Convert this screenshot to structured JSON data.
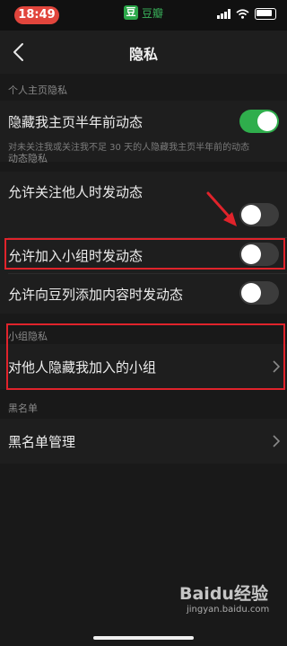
{
  "status_bar": {
    "time": "18:49",
    "app_name": "豆瓣",
    "app_logo": "豆"
  },
  "nav": {
    "title": "隐私",
    "back_icon": "chevron-left-icon"
  },
  "sections": {
    "profile": {
      "header": "个人主页隐私",
      "hide_old": {
        "label": "隐藏我主页半年前动态",
        "desc": "对未关注我或关注我不足 30 天的人隐藏我主页半年前的动态",
        "enabled": true
      }
    },
    "activity": {
      "header": "动态隐私",
      "items": [
        {
          "label": "允许关注他人时发动态",
          "enabled": false
        },
        {
          "label": "允许加入小组时发动态",
          "enabled": false
        },
        {
          "label": "允许向豆列添加内容时发动态",
          "enabled": false
        }
      ]
    },
    "group": {
      "header": "小组隐私",
      "hide_groups_label": "对他人隐藏我加入的小组"
    },
    "blacklist": {
      "header": "黑名单",
      "manage_label": "黑名单管理"
    }
  },
  "colors": {
    "accent_green": "#2fae4c",
    "highlight_red": "#e0232b",
    "time_pill": "#e1453c"
  },
  "watermark": {
    "brand": "Baidu经验",
    "site": "jingyan.baidu.com"
  }
}
